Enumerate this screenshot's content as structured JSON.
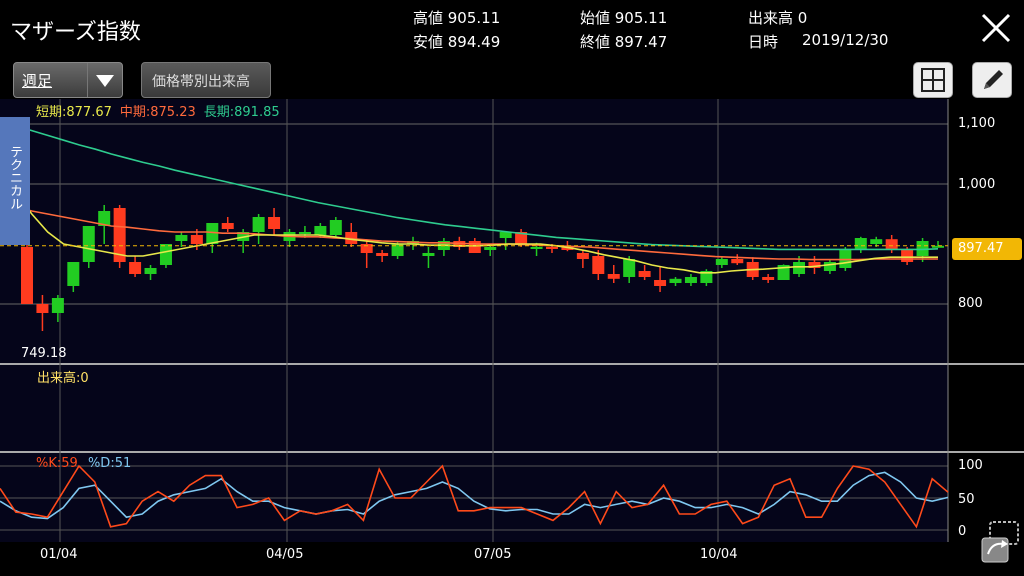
{
  "header": {
    "title": "マザーズ指数",
    "high": "高値 905.11",
    "low": "安値 894.49",
    "open": "始値 905.11",
    "close": "終値 897.47",
    "volume": "出来高 0",
    "date_label": "日時",
    "date": "2019/12/30"
  },
  "toolbar": {
    "period": "週足",
    "price_volume_button": "価格帯別出来高"
  },
  "side_tab": "テクニカル",
  "ma_legend": {
    "short": "短期:877.67",
    "mid": "中期:875.23",
    "long": "長期:891.85"
  },
  "low_marker": "749.18",
  "price_badge": "897.47",
  "volume_label": "出来高:0",
  "stoch_legend": {
    "k": "%K:59",
    "d": "%D:51"
  },
  "y_ticks": [
    "1,100",
    "1,000",
    "800"
  ],
  "stoch_ticks": [
    "100",
    "50",
    "0"
  ],
  "x_ticks": [
    "01/04",
    "04/05",
    "07/05",
    "10/04"
  ],
  "colors": {
    "up": "#22cc22",
    "down": "#ff3b1f",
    "short": "#e8e84a",
    "mid": "#ff6a3c",
    "long": "#2ecc8f",
    "k": "#ff4a1a",
    "d": "#7fc7f0",
    "badge": "#f2b705"
  },
  "chart_data": {
    "type": "candlestick",
    "x_ticks": [
      "01/04",
      "04/05",
      "07/05",
      "10/04"
    ],
    "ylim": [
      700,
      1130
    ],
    "candles": [
      [
        895,
        935,
        800,
        800
      ],
      [
        800,
        815,
        755,
        785
      ],
      [
        785,
        815,
        770,
        810
      ],
      [
        830,
        870,
        820,
        870
      ],
      [
        870,
        930,
        860,
        930
      ],
      [
        930,
        965,
        900,
        955
      ],
      [
        960,
        965,
        860,
        870
      ],
      [
        870,
        880,
        845,
        850
      ],
      [
        850,
        865,
        840,
        860
      ],
      [
        865,
        900,
        860,
        900
      ],
      [
        905,
        920,
        895,
        915
      ],
      [
        915,
        925,
        890,
        900
      ],
      [
        900,
        935,
        885,
        935
      ],
      [
        935,
        945,
        920,
        925
      ],
      [
        905,
        925,
        885,
        920
      ],
      [
        920,
        950,
        900,
        945
      ],
      [
        945,
        960,
        915,
        925
      ],
      [
        905,
        925,
        895,
        920
      ],
      [
        920,
        930,
        910,
        920
      ],
      [
        915,
        935,
        910,
        930
      ],
      [
        915,
        945,
        910,
        940
      ],
      [
        920,
        935,
        895,
        900
      ],
      [
        900,
        908,
        860,
        885
      ],
      [
        885,
        890,
        870,
        880
      ],
      [
        880,
        905,
        875,
        900
      ],
      [
        900,
        912,
        890,
        905
      ],
      [
        880,
        895,
        860,
        885
      ],
      [
        890,
        910,
        880,
        905
      ],
      [
        905,
        912,
        890,
        895
      ],
      [
        905,
        910,
        885,
        885
      ],
      [
        890,
        900,
        880,
        895
      ],
      [
        910,
        920,
        890,
        920
      ],
      [
        920,
        925,
        895,
        900
      ],
      [
        895,
        902,
        880,
        895
      ],
      [
        895,
        900,
        885,
        893
      ],
      [
        895,
        905,
        888,
        890
      ],
      [
        885,
        890,
        860,
        875
      ],
      [
        880,
        890,
        840,
        850
      ],
      [
        850,
        865,
        835,
        842
      ],
      [
        845,
        880,
        835,
        875
      ],
      [
        855,
        865,
        840,
        845
      ],
      [
        840,
        862,
        820,
        830
      ],
      [
        835,
        845,
        830,
        842
      ],
      [
        835,
        850,
        830,
        845
      ],
      [
        835,
        858,
        830,
        855
      ],
      [
        865,
        880,
        860,
        875
      ],
      [
        875,
        883,
        865,
        868
      ],
      [
        870,
        878,
        840,
        845
      ],
      [
        845,
        850,
        835,
        840
      ],
      [
        840,
        866,
        840,
        865
      ],
      [
        850,
        880,
        845,
        870
      ],
      [
        870,
        880,
        850,
        860
      ],
      [
        855,
        875,
        850,
        870
      ],
      [
        860,
        895,
        855,
        890
      ],
      [
        890,
        912,
        885,
        910
      ],
      [
        900,
        912,
        895,
        908
      ],
      [
        908,
        915,
        885,
        890
      ],
      [
        890,
        895,
        865,
        870
      ],
      [
        880,
        910,
        870,
        905
      ],
      [
        897,
        905,
        894,
        897
      ]
    ],
    "ma_short": [
      1010,
      985,
      950,
      920,
      900,
      895,
      890,
      885,
      880,
      880,
      885,
      890,
      895,
      900,
      905,
      910,
      915,
      915,
      915,
      915,
      915,
      912,
      908,
      905,
      902,
      900,
      900,
      898,
      898,
      897,
      897,
      898,
      900,
      900,
      900,
      897,
      893,
      888,
      882,
      877,
      872,
      865,
      860,
      857,
      852,
      852,
      855,
      857,
      858,
      860,
      862,
      862,
      865,
      868,
      872,
      876,
      878,
      878,
      878,
      878
    ],
    "ma_mid": [
      970,
      962,
      955,
      950,
      945,
      940,
      935,
      930,
      928,
      925,
      922,
      920,
      920,
      920,
      918,
      918,
      917,
      915,
      913,
      912,
      912,
      910,
      909,
      907,
      905,
      904,
      903,
      902,
      902,
      901,
      900,
      900,
      900,
      899,
      898,
      897,
      896,
      895,
      893,
      891,
      889,
      887,
      885,
      883,
      881,
      879,
      878,
      877,
      876,
      875,
      875,
      874,
      874,
      874,
      874,
      875,
      875,
      875,
      875,
      875
    ],
    "ma_long": [
      1105,
      1097,
      1089,
      1081,
      1073,
      1065,
      1058,
      1050,
      1043,
      1036,
      1030,
      1023,
      1017,
      1011,
      1005,
      999,
      993,
      987,
      981,
      975,
      969,
      964,
      959,
      954,
      949,
      944,
      940,
      936,
      932,
      929,
      926,
      923,
      920,
      917,
      914,
      911,
      909,
      907,
      905,
      903,
      901,
      899,
      898,
      897,
      896,
      895,
      894,
      893,
      892,
      891,
      891,
      891,
      891,
      891,
      891,
      891,
      891,
      891,
      891,
      892
    ],
    "stoch_k": [
      65,
      28,
      25,
      20,
      60,
      100,
      75,
      5,
      10,
      45,
      60,
      45,
      70,
      85,
      85,
      35,
      40,
      50,
      15,
      30,
      25,
      30,
      40,
      15,
      95,
      50,
      50,
      75,
      100,
      30,
      30,
      35,
      35,
      35,
      25,
      15,
      35,
      60,
      10,
      60,
      35,
      40,
      70,
      25,
      25,
      40,
      45,
      10,
      20,
      70,
      80,
      20,
      20,
      65,
      100,
      95,
      75,
      40,
      5,
      80,
      59
    ],
    "stoch_d": [
      45,
      30,
      20,
      18,
      35,
      65,
      70,
      45,
      20,
      25,
      45,
      55,
      60,
      65,
      80,
      60,
      45,
      45,
      35,
      30,
      25,
      30,
      32,
      25,
      45,
      55,
      60,
      65,
      75,
      65,
      45,
      33,
      30,
      32,
      32,
      25,
      25,
      40,
      35,
      40,
      45,
      40,
      50,
      45,
      35,
      35,
      40,
      35,
      25,
      40,
      60,
      55,
      45,
      45,
      70,
      85,
      90,
      75,
      50,
      45,
      51
    ]
  }
}
